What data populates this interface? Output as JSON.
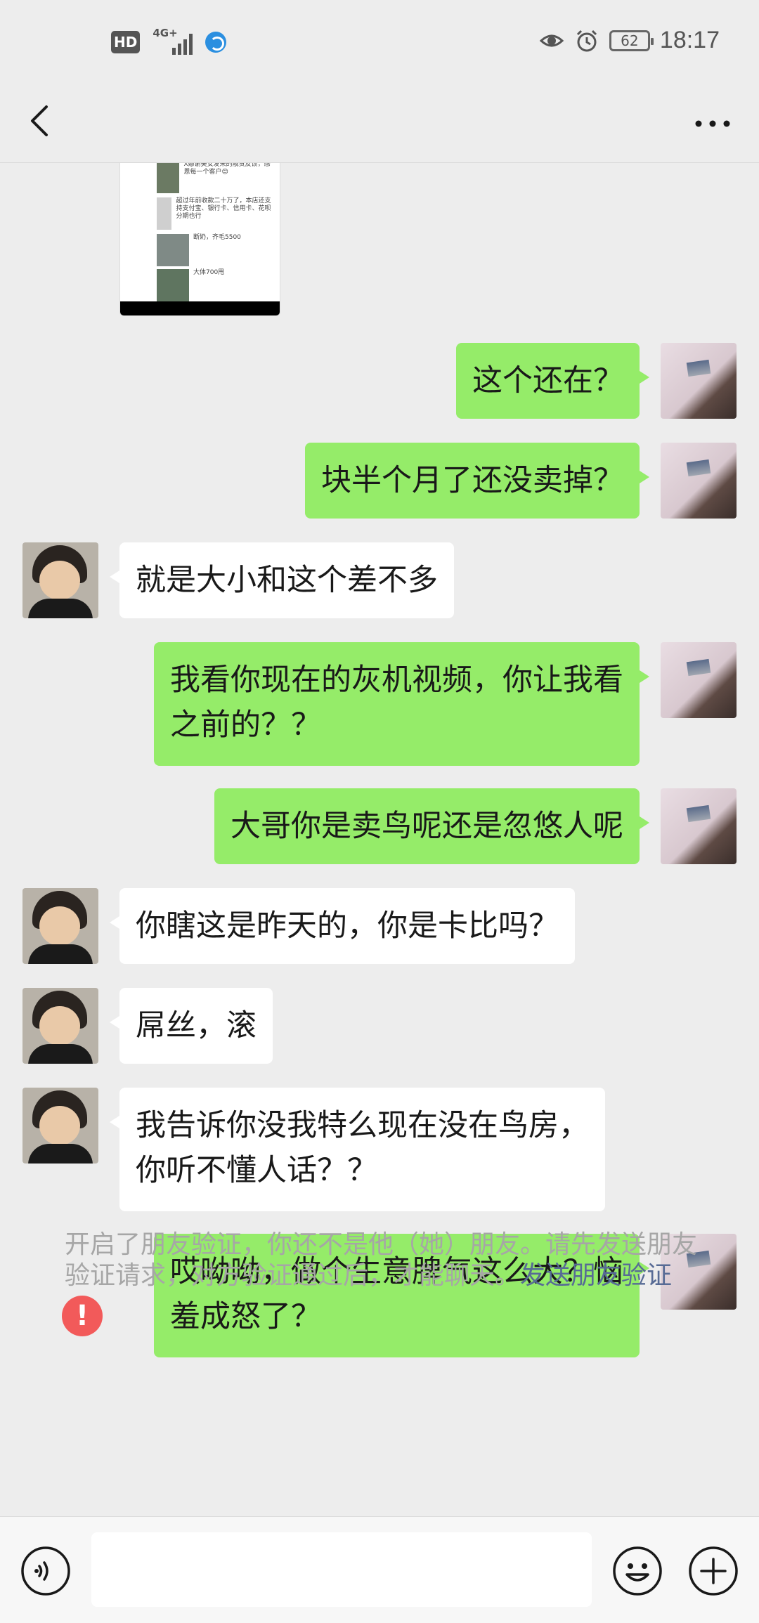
{
  "status_bar": {
    "hd_label": "HD",
    "network_label": "4G+",
    "battery_level": "62",
    "time": "18:17"
  },
  "nav": {
    "back_icon": "chevron-left-icon",
    "more_icon": "more-dots-icon"
  },
  "shared_thumbnail": {
    "captions": [
      "X娜谢美女发来的靓货反馈，感恩每一个客户😊",
      "超过年前收款二十万了，本店还支持支付宝、银行卡、信用卡、花呗分期也行",
      "断奶，齐毛5500",
      "大体700甩"
    ]
  },
  "messages": [
    {
      "side": "me",
      "text": "这个还在？"
    },
    {
      "side": "me",
      "text": "块半个月了还没卖掉？"
    },
    {
      "side": "other",
      "text": "就是大小和这个差不多"
    },
    {
      "side": "me",
      "text": "我看你现在的灰机视频，你让我看\n之前的？？"
    },
    {
      "side": "me",
      "text": "大哥你是卖鸟呢还是忽悠人呢"
    },
    {
      "side": "other",
      "text": "你瞎这是昨天的，你是卡比吗？"
    },
    {
      "side": "other",
      "text": "屌丝，滚"
    },
    {
      "side": "other",
      "text": "我告诉你没我特么现在没在鸟房，\n你听不懂人话？？"
    },
    {
      "side": "me",
      "text": "哎呦呦，做个生意脾气这么大？恼\n羞成怒了？",
      "error": "!"
    }
  ],
  "system_note": {
    "text": "开启了朋友验证，你还不是他（她）朋友。请先发送朋友验证请求，对方验证通过后，才能聊天。",
    "link": "发送朋友验证"
  },
  "input_bar": {
    "voice_icon": "voice-icon",
    "emoji_icon": "emoji-icon",
    "plus_icon": "plus-icon"
  },
  "colors": {
    "my_bubble": "#95ec69",
    "other_bubble": "#ffffff",
    "background": "#ededed",
    "link": "#576b95",
    "error": "#f25a5a"
  }
}
